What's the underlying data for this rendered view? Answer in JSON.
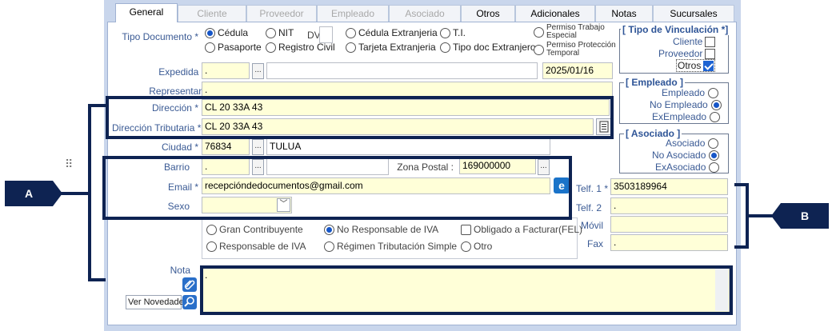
{
  "tabs": [
    {
      "label": "General",
      "state": "active"
    },
    {
      "label": "Cliente",
      "state": "disabled"
    },
    {
      "label": "Proveedor",
      "state": "disabled"
    },
    {
      "label": "Empleado",
      "state": "disabled"
    },
    {
      "label": "Asociado",
      "state": "disabled"
    },
    {
      "label": "Otros",
      "state": "normal"
    },
    {
      "label": "Adicionales",
      "state": "normal"
    },
    {
      "label": "Notas",
      "state": "normal"
    },
    {
      "label": "Sucursales",
      "state": "normal"
    }
  ],
  "tipo_documento": {
    "label": "Tipo Documento *",
    "dv_label": "DV",
    "options": [
      {
        "label": "Cédula",
        "selected": true
      },
      {
        "label": "NIT",
        "selected": false
      },
      {
        "label": "Cédula Extranjeria",
        "selected": false
      },
      {
        "label": "T.I.",
        "selected": false
      },
      {
        "label": "Permiso Trabajo Especial",
        "selected": false
      },
      {
        "label": "Pasaporte",
        "selected": false
      },
      {
        "label": "Registro Civil",
        "selected": false
      },
      {
        "label": "Tarjeta Extranjeria",
        "selected": false
      },
      {
        "label": "Tipo doc Extranjero",
        "selected": false
      },
      {
        "label": "Permiso Protección Temporal",
        "selected": false
      }
    ]
  },
  "expedida": {
    "label": "Expedida en",
    "code": ".",
    "date": "2025/01/16"
  },
  "representante": {
    "label": "Representante",
    "value": "."
  },
  "direccion": {
    "label": "Dirección *",
    "value": "CL 20 33A 43"
  },
  "direccion_tributaria": {
    "label": "Dirección Tributaria *",
    "value": "CL 20 33A 43"
  },
  "ciudad": {
    "label": "Ciudad *",
    "code": "76834",
    "name": "TULUA"
  },
  "barrio": {
    "label": "Barrio",
    "value": "."
  },
  "zona_postal": {
    "label": "Zona Postal :",
    "value": "169000000"
  },
  "email": {
    "label": "Email *",
    "value": "recepcióndedocumentos@gmail.com"
  },
  "sexo": {
    "label": "Sexo",
    "value": ""
  },
  "telefonos": [
    {
      "label": "Telf. 1 *",
      "value": "3503189964"
    },
    {
      "label": "Telf. 2",
      "value": "."
    },
    {
      "label": "Móvil",
      "value": ""
    },
    {
      "label": "Fax",
      "value": "."
    }
  ],
  "regimen": [
    {
      "label": "Gran Contribuyente",
      "selected": false,
      "kind": "radio"
    },
    {
      "label": "No Responsable de IVA",
      "selected": true,
      "kind": "radio"
    },
    {
      "label": "Obligado a Facturar(FEL)",
      "selected": false,
      "kind": "check"
    },
    {
      "label": "Responsable de IVA",
      "selected": false,
      "kind": "radio"
    },
    {
      "label": "Régimen Tributación Simple",
      "selected": false,
      "kind": "radio"
    },
    {
      "label": "Otro",
      "selected": false,
      "kind": "radio"
    }
  ],
  "nota": {
    "label": "Nota",
    "value": ".",
    "ver_novedades": "Ver Novedades"
  },
  "vinculacion": {
    "title": "[ Tipo de Vinculación *]",
    "items": [
      {
        "label": "Cliente",
        "checked": false
      },
      {
        "label": "Proveedor",
        "checked": false
      },
      {
        "label": "Otros",
        "checked": true
      }
    ]
  },
  "empleado": {
    "title": "[ Empleado ]",
    "items": [
      {
        "label": "Empleado",
        "selected": false
      },
      {
        "label": "No Empleado",
        "selected": true
      },
      {
        "label": "ExEmpleado",
        "selected": false
      }
    ]
  },
  "asociado": {
    "title": "[ Asociado ]",
    "items": [
      {
        "label": "Asociado",
        "selected": false
      },
      {
        "label": "No Asociado",
        "selected": true
      },
      {
        "label": "ExAsociado",
        "selected": false
      }
    ]
  },
  "annotations": {
    "a": "A",
    "b": "B"
  },
  "colors": {
    "accent": "#1656c8",
    "highlight": "#0e2352",
    "field_bg": "#ffffd8"
  }
}
